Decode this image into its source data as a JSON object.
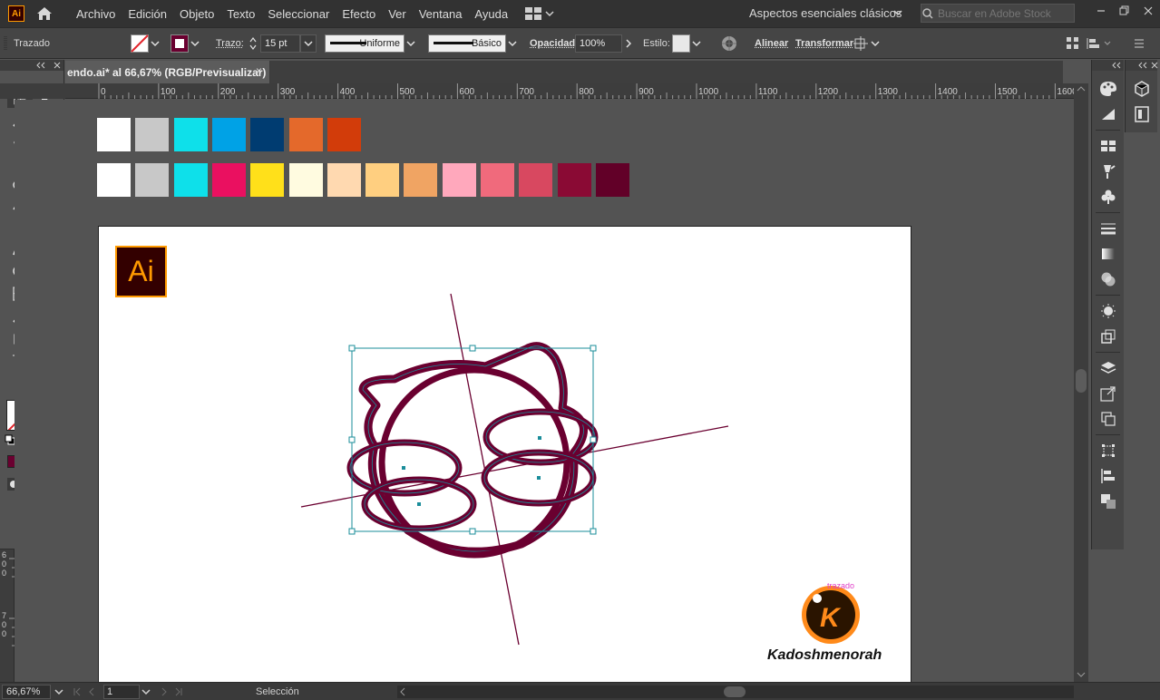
{
  "app": {
    "logo_text": "Ai"
  },
  "menu": {
    "items": [
      "Archivo",
      "Edición",
      "Objeto",
      "Texto",
      "Seleccionar",
      "Efecto",
      "Ver",
      "Ventana",
      "Ayuda"
    ]
  },
  "workspace": {
    "name": "Aspectos esenciales clásicos"
  },
  "search": {
    "placeholder": "Buscar en Adobe Stock"
  },
  "control": {
    "selection_type": "Trazado",
    "stroke_label": "Trazo:",
    "stroke_weight": "15 pt",
    "profile_uniform": "Uniforme",
    "brush_basic": "Básico",
    "opacity_label": "Opacidad:",
    "opacity_value": "100%",
    "style_label": "Estilo:",
    "align_label": "Alinear",
    "transform_label": "Transformar"
  },
  "document": {
    "tab_title": "endo.ai* al 66,67% (RGB/Previsualizar)",
    "close_glyph": "×"
  },
  "ruler": {
    "ticks": [
      "0",
      "100",
      "200",
      "300",
      "400",
      "500",
      "600",
      "700",
      "800",
      "900",
      "1000",
      "1100",
      "1200",
      "1300",
      "1400",
      "1500",
      "1600"
    ],
    "left_labels": [
      "6",
      "0",
      "0",
      "7",
      "0",
      "0"
    ]
  },
  "swatches": {
    "row1": [
      "#ffffff",
      "#c8c8c8",
      "#0ee0ea",
      "#00a2e6",
      "#003c71",
      "#e4692b",
      "#d23c0a"
    ],
    "row2": [
      "#ffffff",
      "#c8c8c8",
      "#0ee0ea",
      "#ea1060",
      "#ffe01a",
      "#fffbe0",
      "#ffd9b0",
      "#ffcf80",
      "#f0a463",
      "#ffa8bc",
      "#f06a7c",
      "#d84860",
      "#8a0a34",
      "#620028"
    ]
  },
  "artwork": {
    "stroke_color": "#6a0030",
    "selection_color": "#1a8d9a",
    "guide_color": "#6a0030"
  },
  "logo_mark": {
    "ai_badge": "Ai",
    "watermark_letter": "K",
    "watermark_name": "Kadoshmenorah",
    "hint_text": "trazado"
  },
  "status": {
    "zoom": "66,67%",
    "page": "1",
    "tool": "Selección"
  },
  "colors": {
    "fill": "#ffffff",
    "stroke": "#6a0030"
  }
}
